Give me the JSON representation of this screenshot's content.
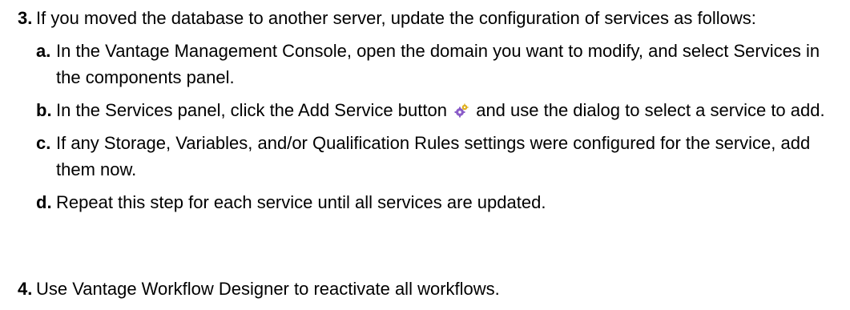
{
  "steps": [
    {
      "number": "3.",
      "text": "If you moved the database to another server, update the configuration of services as follows:",
      "substeps": [
        {
          "letter": "a.",
          "text": "In the Vantage Management Console, open the domain you want to modify, and select Services in the components panel."
        },
        {
          "letter": "b.",
          "text_before": "In the Services panel, click the Add Service button",
          "icon": "add-service-gears-icon",
          "text_after": "and use the dialog to select a service to add."
        },
        {
          "letter": "c.",
          "text": "If any Storage, Variables, and/or Qualification Rules settings were configured for the service, add them now."
        },
        {
          "letter": "d.",
          "text": "Repeat this step for each service until all services are updated."
        }
      ]
    },
    {
      "number": "4.",
      "text": "Use Vantage Workflow Designer to reactivate all workflows."
    }
  ],
  "colors": {
    "text": "#000000",
    "background": "#ffffff",
    "icon_primary": "#8a5cc8",
    "icon_secondary": "#e0b020"
  }
}
